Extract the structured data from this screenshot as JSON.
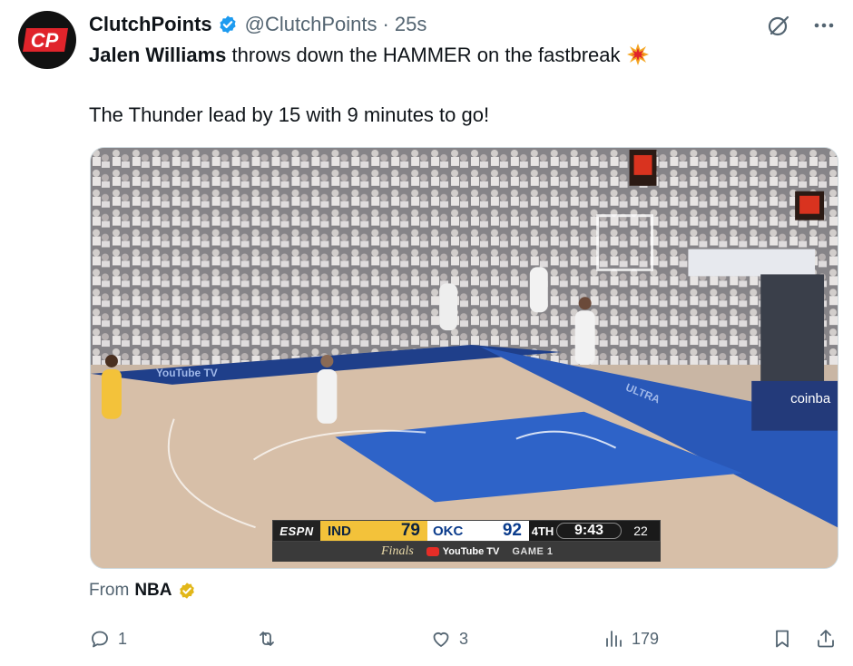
{
  "author": {
    "display_name": "ClutchPoints",
    "handle": "@ClutchPoints",
    "separator": "·",
    "time": "25s",
    "avatar_text": "CP",
    "verified_color": "#1d9bf0"
  },
  "tweet": {
    "line1_bold": "Jalen Williams",
    "line1_rest": " throws down the HAMMER on the fastbreak",
    "line1_emoji": "collision-icon",
    "line2": "The Thunder lead by 15 with 9 minutes to go!"
  },
  "media": {
    "type": "video-frame",
    "court_sign_left": "YouTube TV",
    "court_sign_right": "coinba",
    "baseline_text": "ULTRA",
    "scorebug": {
      "network": "ESPN",
      "team1": "IND",
      "score1": "79",
      "team2": "OKC",
      "score2": "92",
      "quarter": "4TH",
      "clock": "9:43",
      "shot_clock": "22",
      "event": "Finals",
      "sponsor": "YouTube TV",
      "game": "GAME 1"
    }
  },
  "source": {
    "prefix": "From",
    "name": "NBA",
    "badge_color": "#e2b719"
  },
  "actions": {
    "reply_count": "1",
    "retweet_count": "",
    "like_count": "3",
    "views_count": "179"
  },
  "colors": {
    "text_primary": "#0f1419",
    "text_secondary": "#536471",
    "accent": "#1d9bf0"
  }
}
